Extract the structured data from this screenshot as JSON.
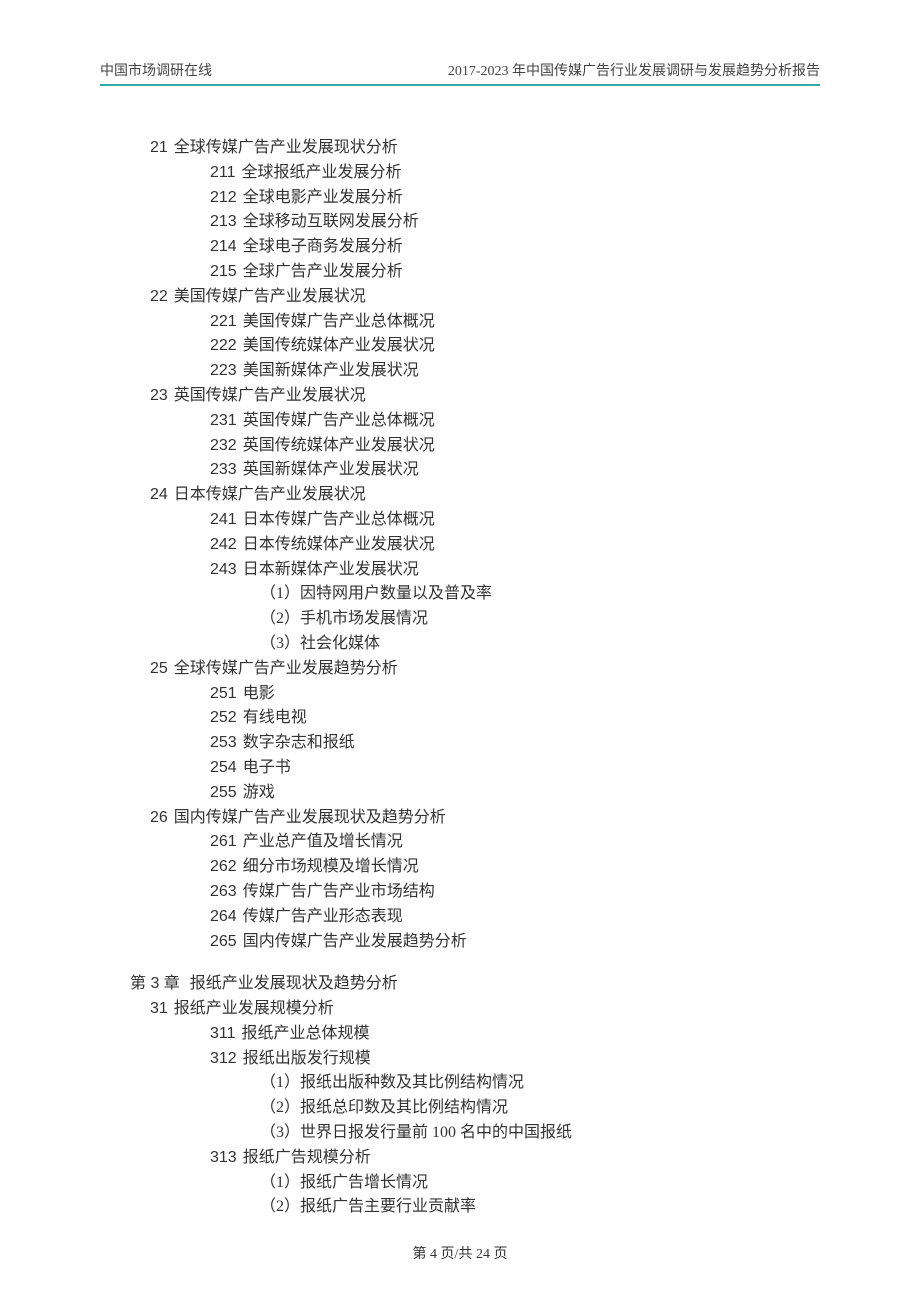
{
  "header": {
    "left": "中国市场调研在线",
    "right": "2017-2023    年中国传媒广告行业发展调研与发展趋势分析报告"
  },
  "toc": [
    {
      "l": 1,
      "n": "21",
      "t": "全球传媒广告产业发展现状分析"
    },
    {
      "l": 2,
      "n": "211",
      "t": "全球报纸产业发展分析"
    },
    {
      "l": 2,
      "n": "212",
      "t": "全球电影产业发展分析"
    },
    {
      "l": 2,
      "n": "213",
      "t": "全球移动互联网发展分析"
    },
    {
      "l": 2,
      "n": "214",
      "t": "全球电子商务发展分析"
    },
    {
      "l": 2,
      "n": "215",
      "t": "全球广告产业发展分析"
    },
    {
      "l": 1,
      "n": "22",
      "t": "美国传媒广告产业发展状况"
    },
    {
      "l": 2,
      "n": "221",
      "t": "美国传媒广告产业总体概况"
    },
    {
      "l": 2,
      "n": "222",
      "t": "美国传统媒体产业发展状况"
    },
    {
      "l": 2,
      "n": "223",
      "t": "美国新媒体产业发展状况"
    },
    {
      "l": 1,
      "n": "23",
      "t": "英国传媒广告产业发展状况"
    },
    {
      "l": 2,
      "n": "231",
      "t": "英国传媒广告产业总体概况"
    },
    {
      "l": 2,
      "n": "232",
      "t": "英国传统媒体产业发展状况"
    },
    {
      "l": 2,
      "n": "233",
      "t": "英国新媒体产业发展状况"
    },
    {
      "l": 1,
      "n": "24",
      "t": "日本传媒广告产业发展状况"
    },
    {
      "l": 2,
      "n": "241",
      "t": "日本传媒广告产业总体概况"
    },
    {
      "l": 2,
      "n": "242",
      "t": "日本传统媒体产业发展状况"
    },
    {
      "l": 2,
      "n": "243",
      "t": "日本新媒体产业发展状况"
    },
    {
      "l": 3,
      "n": "",
      "t": "（1）因特网用户数量以及普及率"
    },
    {
      "l": 3,
      "n": "",
      "t": "（2）手机市场发展情况"
    },
    {
      "l": 3,
      "n": "",
      "t": "（3）社会化媒体"
    },
    {
      "l": 1,
      "n": "25",
      "t": "全球传媒广告产业发展趋势分析"
    },
    {
      "l": 2,
      "n": "251",
      "t": "电影"
    },
    {
      "l": 2,
      "n": "252",
      "t": "有线电视"
    },
    {
      "l": 2,
      "n": "253",
      "t": "数字杂志和报纸"
    },
    {
      "l": 2,
      "n": "254",
      "t": "电子书"
    },
    {
      "l": 2,
      "n": "255",
      "t": "游戏"
    },
    {
      "l": 1,
      "n": "26",
      "t": "国内传媒广告产业发展现状及趋势分析"
    },
    {
      "l": 2,
      "n": "261",
      "t": "产业总产值及增长情况"
    },
    {
      "l": 2,
      "n": "262",
      "t": "细分市场规模及增长情况"
    },
    {
      "l": 2,
      "n": "263",
      "t": "传媒广告广告产业市场结构"
    },
    {
      "l": 2,
      "n": "264",
      "t": "传媒广告产业形态表现"
    },
    {
      "l": 2,
      "n": "265",
      "t": "国内传媒广告产业发展趋势分析"
    },
    {
      "l": 0,
      "n": "第 3 章",
      "t": "   报纸产业发展现状及趋势分析"
    },
    {
      "l": 1,
      "n": "31",
      "t": "报纸产业发展规模分析"
    },
    {
      "l": 2,
      "n": "311",
      "t": "报纸产业总体规模"
    },
    {
      "l": 2,
      "n": "312",
      "t": "报纸出版发行规模"
    },
    {
      "l": 3,
      "n": "",
      "t": "（1）报纸出版种数及其比例结构情况"
    },
    {
      "l": 3,
      "n": "",
      "t": "（2）报纸总印数及其比例结构情况"
    },
    {
      "l": 3,
      "n": "",
      "t": "（3）世界日报发行量前 100 名中的中国报纸"
    },
    {
      "l": 2,
      "n": "313",
      "t": "报纸广告规模分析"
    },
    {
      "l": 3,
      "n": "",
      "t": "（1）报纸广告增长情况"
    },
    {
      "l": 3,
      "n": "",
      "t": "（2）报纸广告主要行业贡献率"
    }
  ],
  "footer": {
    "prefix": "第 ",
    "current": "4",
    "mid": " 页/共 ",
    "total": "24",
    "suffix": " 页"
  }
}
